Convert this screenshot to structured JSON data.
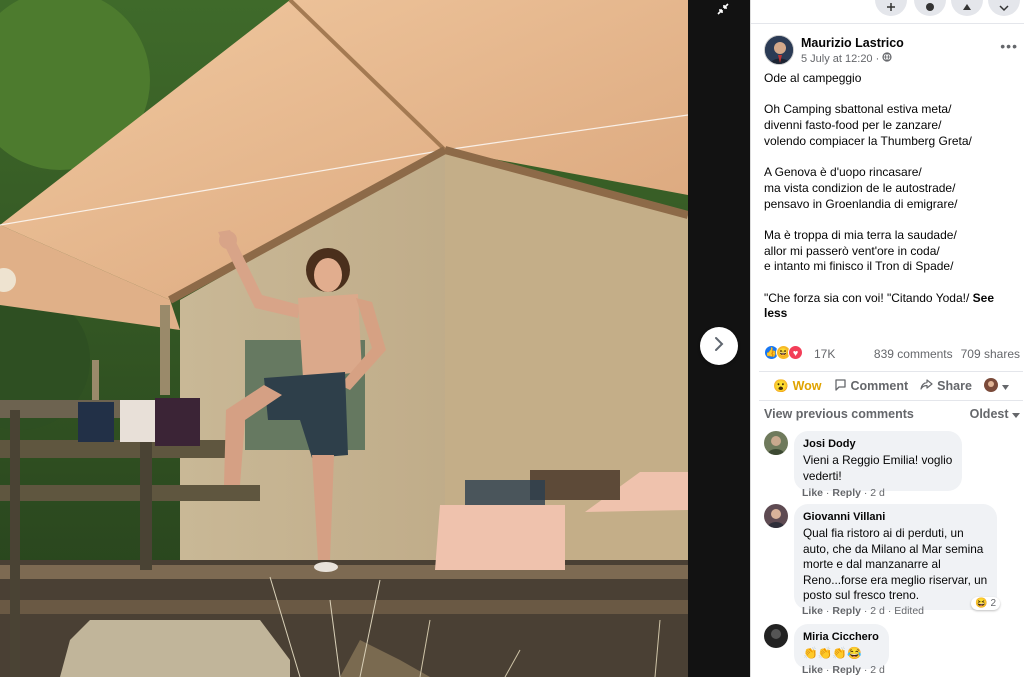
{
  "photo": {
    "description_icon": "campsite-photo"
  },
  "navigation": {
    "collapse_icon": "collapse-arrows-icon",
    "next_icon": "chevron-right-icon"
  },
  "post": {
    "author": "Maurizio Lastrico",
    "date": "5 July at 12:20",
    "audience_icon": "globe-icon",
    "more_label": "•••",
    "title": "Ode al campeggio",
    "stanzas": [
      [
        "Oh Camping sbattonal estiva meta/",
        "divenni fasto-food per le zanzare/",
        "volendo compiacer la Thumberg Greta/"
      ],
      [
        "A Genova è d'uopo rincasare/",
        "ma vista condizion de le autostrade/",
        "pensavo in Groenlandia di emigrare/"
      ],
      [
        "Ma è troppa di mia terra la saudade/",
        "allor mi passerò vent'ore in coda/",
        "e intanto mi finisco il Tron di Spade/"
      ]
    ],
    "last_line": "\"Che forza sia con voi! \"Citando Yoda!/ ",
    "see_less": "See less"
  },
  "stats": {
    "reactions": [
      "like",
      "haha",
      "love"
    ],
    "reaction_count": "17K",
    "comments": "839 comments",
    "shares": "709 shares"
  },
  "actions": {
    "wow": "Wow",
    "comment": "Comment",
    "share": "Share"
  },
  "comments_section": {
    "view_previous": "View previous comments",
    "sort": "Oldest",
    "items": [
      {
        "name": "Josi Dody",
        "lines": [
          "Vieni a Reggio Emilia! voglio",
          "vederti!"
        ],
        "like": "Like",
        "reply": "Reply",
        "age": "2 d",
        "edited": ""
      },
      {
        "name": "Giovanni Villani",
        "lines": [
          "Qual fia ristoro ai di perduti, un",
          "auto, che da Milano al Mar semina",
          "morte e dal manzanarre al",
          "Reno...forse era meglio riservar, un",
          "posto sul fresco treno."
        ],
        "like": "Like",
        "reply": "Reply",
        "age": "2 d",
        "edited": "Edited",
        "reaction_count": "2"
      },
      {
        "name": "Miria Cicchero",
        "lines": [
          "👏👏👏😂"
        ],
        "like": "Like",
        "reply": "Reply",
        "age": "2 d",
        "edited": ""
      }
    ]
  },
  "colors": {
    "accent": "#1877f2",
    "wow": "#f7b928",
    "love": "#f33e58",
    "secondary_text": "#65676b",
    "bubble": "#f0f2f5"
  }
}
